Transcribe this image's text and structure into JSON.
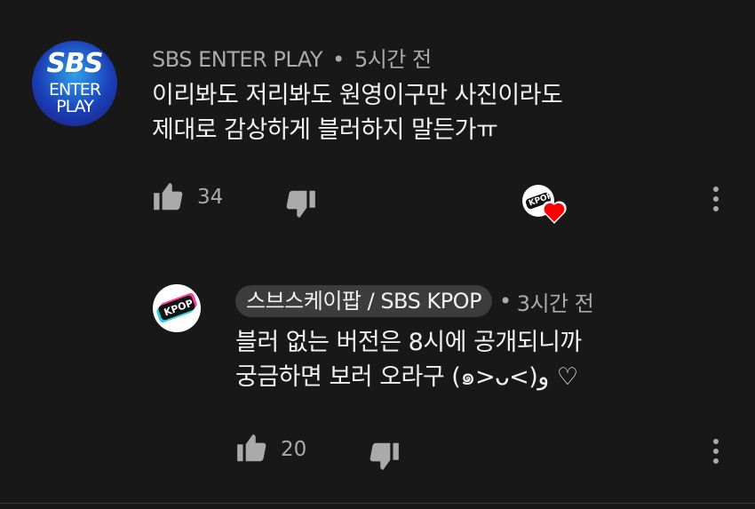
{
  "comment": {
    "author": "SBS ENTER PLAY",
    "separator": "•",
    "time": "5시간 전",
    "lines": [
      "이리봐도 저리봐도 원영이구만 사진이라도",
      "제대로 감상하게 블러하지 말든가ㅠ"
    ],
    "likes": "34",
    "avatar": {
      "line1": "SBS",
      "line2": "ENTER",
      "line3": "PLAY"
    },
    "creator_heart_icon": "heart-icon",
    "creator_avatar_label": "KPOP"
  },
  "reply": {
    "author": "스브스케이팝 / SBS KPOP",
    "separator": "•",
    "time": "3시간 전",
    "lines": [
      "블러 없는 버전은 8시에 공개되니까",
      "궁금하면 보러 오라구 (๑>ᴗ<)و ♡"
    ],
    "likes": "20",
    "avatar_label": "KPOP"
  },
  "colors": {
    "background": "#181818",
    "text": "#f1f1f1",
    "secondary": "#aaaaaa",
    "heart": "#ff0000",
    "chip": "#3c3c3c"
  }
}
